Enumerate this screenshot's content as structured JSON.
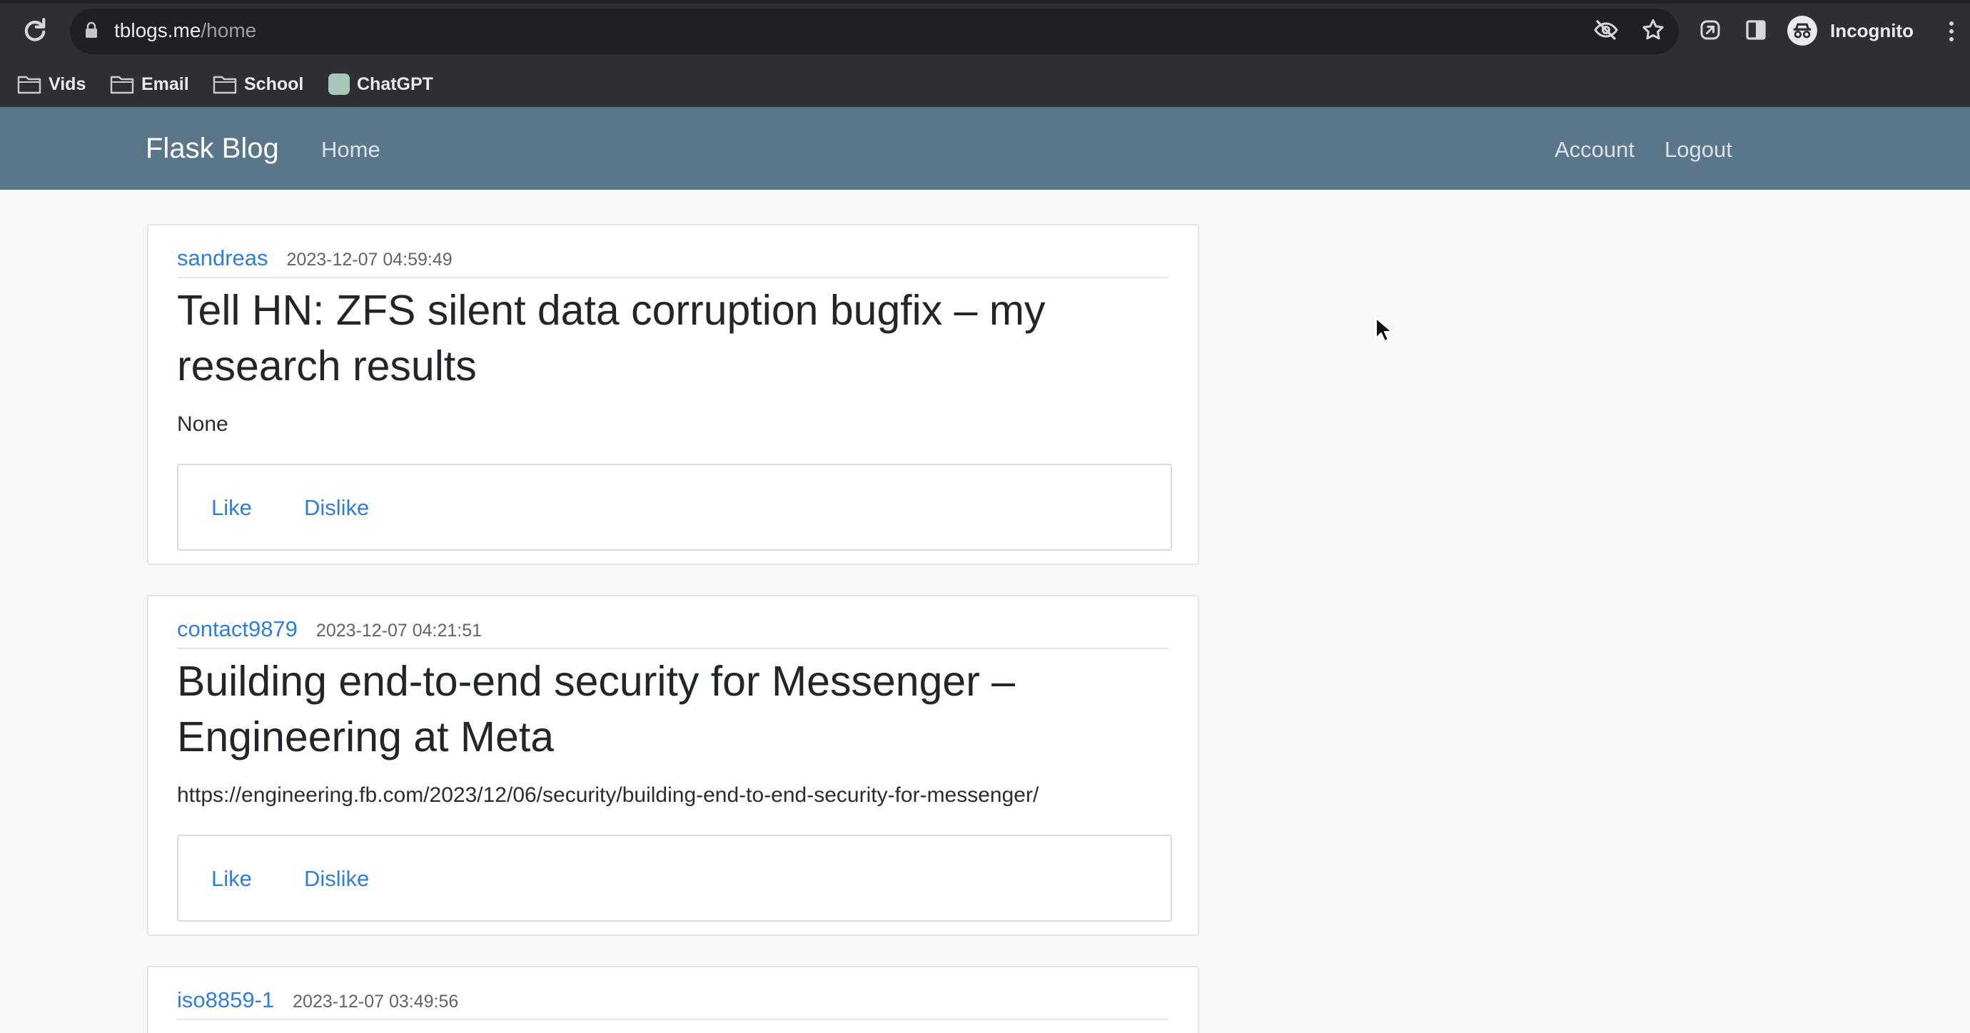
{
  "browser": {
    "url_host": "tblogs.me",
    "url_path": "/home",
    "profile_label": "Incognito",
    "bookmarks": [
      {
        "label": "Vids",
        "icon": "folder-icon"
      },
      {
        "label": "Email",
        "icon": "folder-icon"
      },
      {
        "label": "School",
        "icon": "folder-icon"
      },
      {
        "label": "ChatGPT",
        "icon": "chatgpt-icon"
      }
    ]
  },
  "navbar": {
    "brand": "Flask Blog",
    "home": "Home",
    "account": "Account",
    "logout": "Logout",
    "bg_color": "#5a7689"
  },
  "posts": [
    {
      "author": "sandreas",
      "date": "2023-12-07 04:59:49",
      "title": "Tell HN: ZFS silent data corruption bugfix – my research results",
      "content": "None",
      "like": "Like",
      "dislike": "Dislike"
    },
    {
      "author": "contact9879",
      "date": "2023-12-07 04:21:51",
      "title": "Building end-to-end security for Messenger – Engineering at Meta",
      "content": "https://engineering.fb.com/2023/12/06/security/building-end-to-end-security-for-messenger/",
      "like": "Like",
      "dislike": "Dislike"
    },
    {
      "author": "iso8859-1",
      "date": "2023-12-07 03:49:56"
    }
  ],
  "colors": {
    "link": "#2f7fd6",
    "chrome": "#2d2f33"
  }
}
